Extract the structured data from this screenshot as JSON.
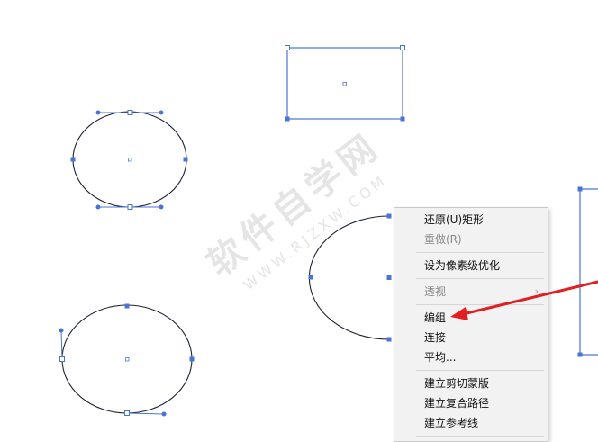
{
  "watermark": {
    "main": "软件自学网",
    "sub": "WWW.RJZXW.COM"
  },
  "context_menu": {
    "items": [
      {
        "label": "还原(U)矩形",
        "enabled": true
      },
      {
        "label": "重做(R)",
        "enabled": false
      },
      {
        "label": "设为像素级优化",
        "enabled": true
      },
      {
        "label": "透视",
        "enabled": false
      },
      {
        "label": "编组",
        "enabled": true
      },
      {
        "label": "连接",
        "enabled": true
      },
      {
        "label": "平均...",
        "enabled": true
      },
      {
        "label": "建立剪切蒙版",
        "enabled": true
      },
      {
        "label": "建立复合路径",
        "enabled": true
      },
      {
        "label": "建立参考线",
        "enabled": true
      }
    ],
    "submenu_glyph": "›"
  },
  "colors": {
    "selection": "#4a73d6",
    "path": "#1c2433",
    "annotation_arrow": "#e02020",
    "menu_bg": "#f2f2f2"
  }
}
